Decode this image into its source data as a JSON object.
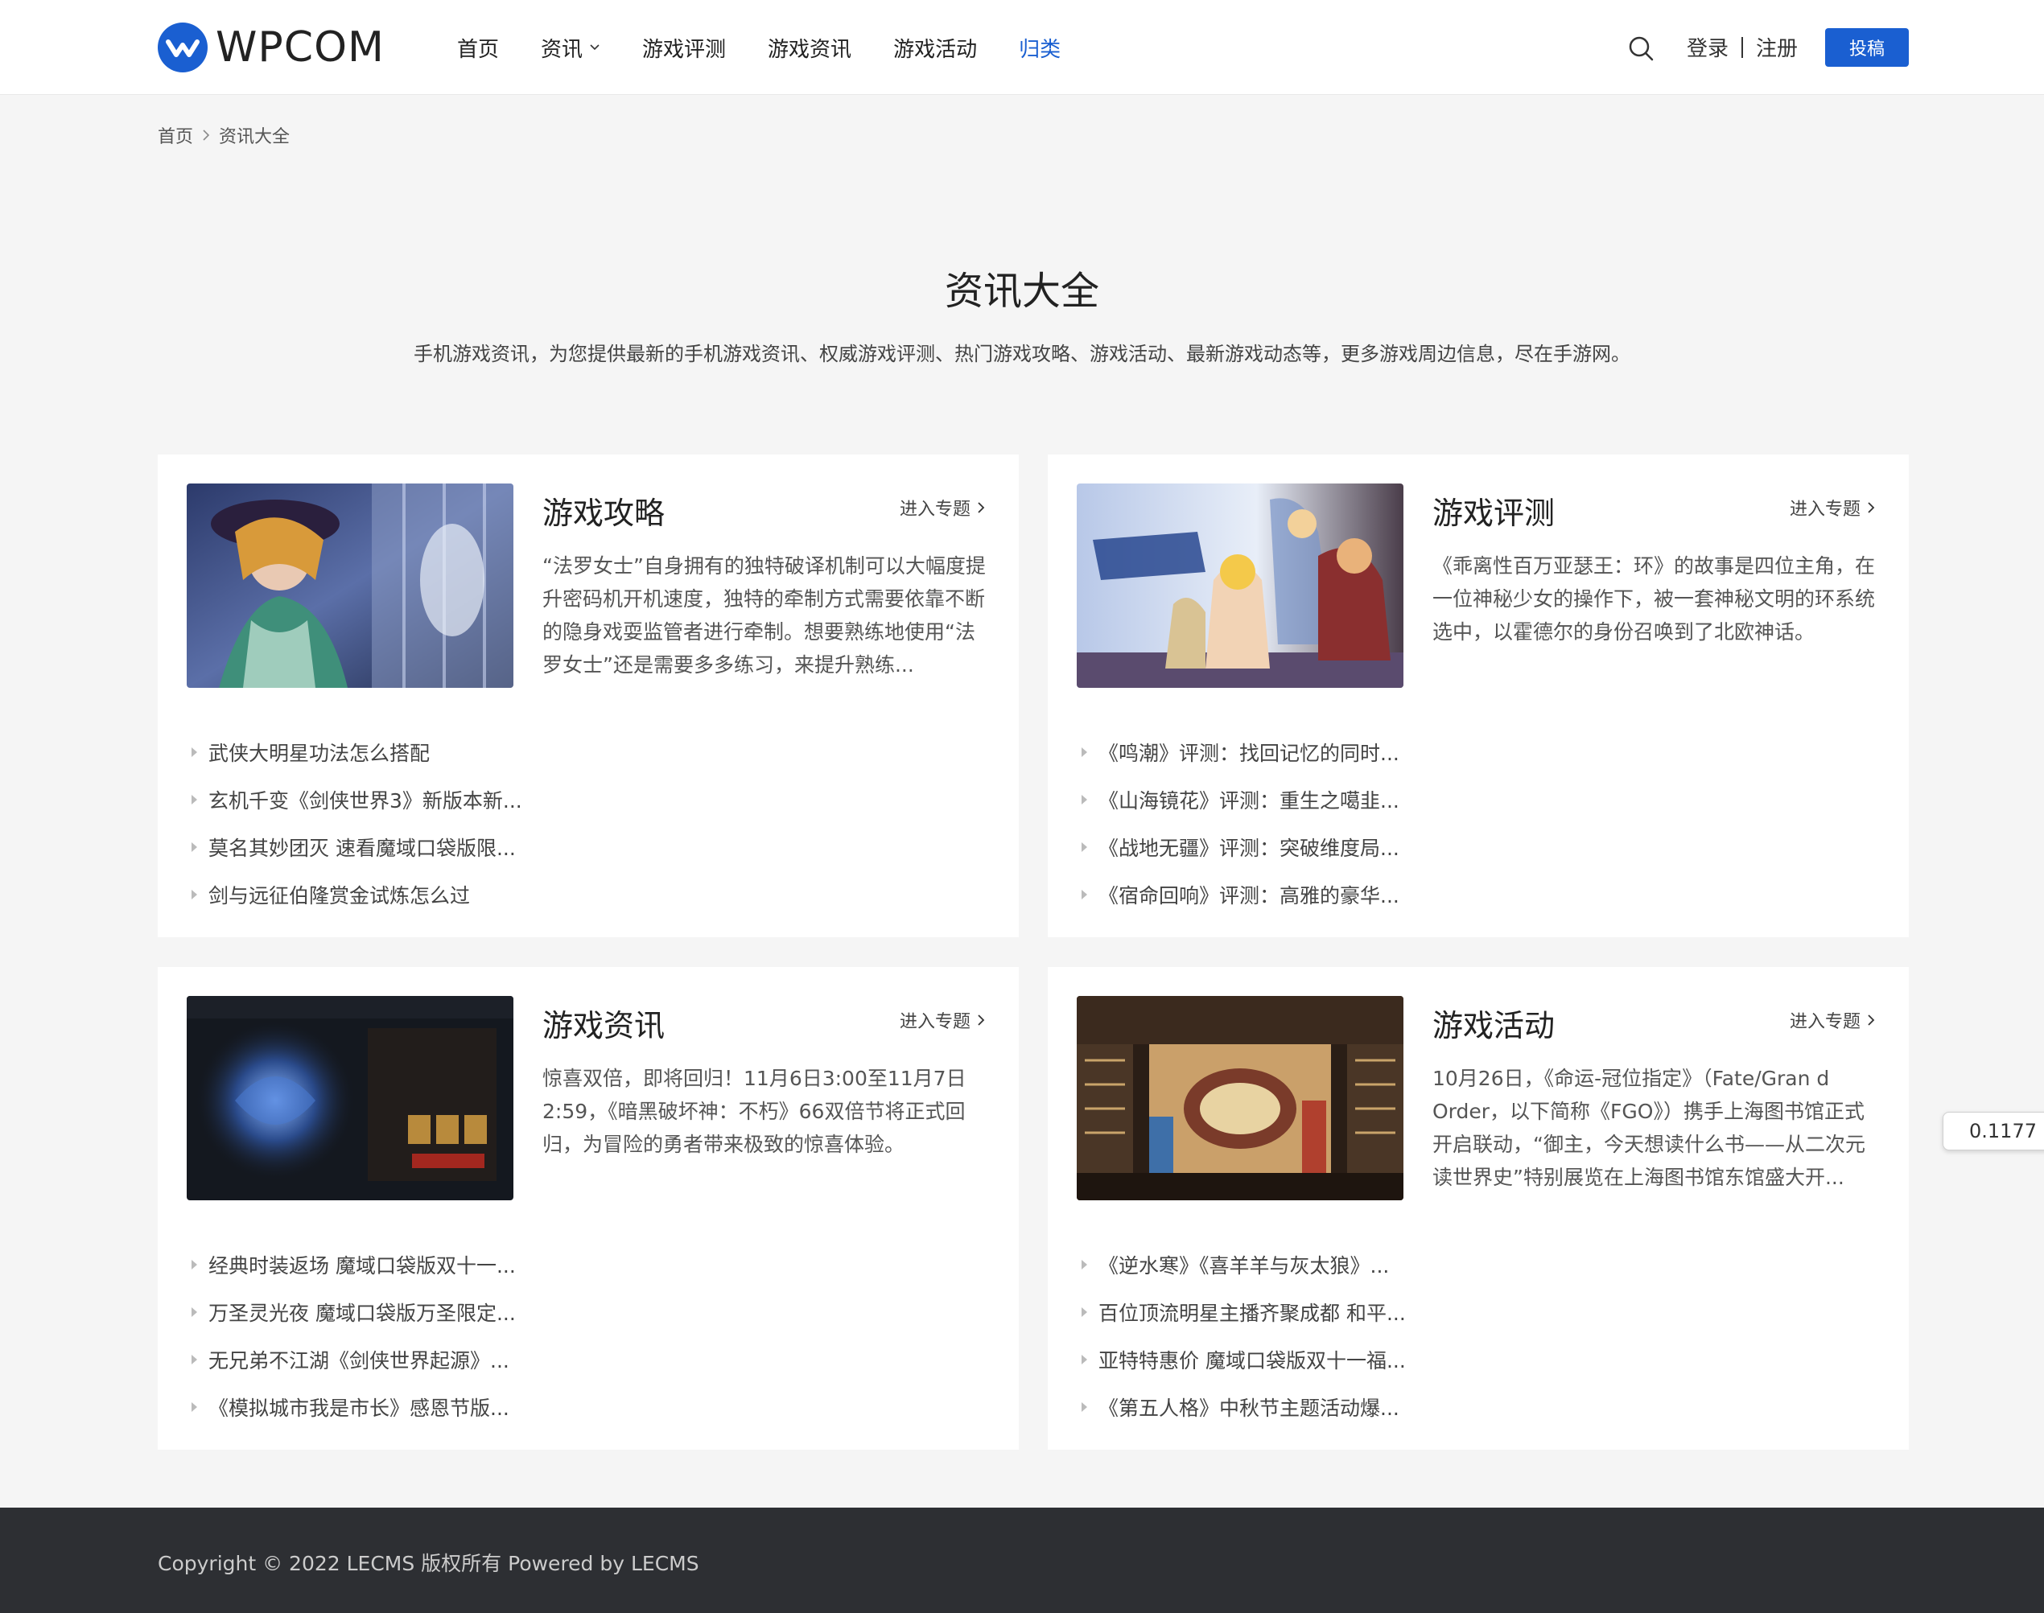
{
  "header": {
    "logo_text": "WPCOM",
    "nav": [
      {
        "label": "首页"
      },
      {
        "label": "资讯"
      },
      {
        "label": "游戏评测"
      },
      {
        "label": "游戏资讯"
      },
      {
        "label": "游戏活动"
      },
      {
        "label": "归类"
      }
    ],
    "login_label": "登录",
    "register_label": "注册",
    "submit_label": "投稿",
    "accent_color": "#1a5fd1"
  },
  "breadcrumb": {
    "home": "首页",
    "current": "资讯大全"
  },
  "page": {
    "title": "资讯大全",
    "description": "手机游戏资讯，为您提供最新的手机游戏资讯、权威游戏评测、热门游戏攻略、游戏活动、最新游戏动态等，更多游戏周边信息，尽在手游网。"
  },
  "cards": [
    {
      "title": "游戏攻略",
      "more_label": "进入专题",
      "excerpt": "“法罗女士”自身拥有的独特破译机制可以大幅度提升密码机开机速度，独特的牵制方式需要依靠不断的隐身戏耍监管者进行牵制。想要熟练地使用“法罗女士”还是需要多多练习，来提升熟练...",
      "items": [
        "武侠大明星功法怎么搭配",
        "玄机千变《剑侠世界3》新版本新...",
        "莫名其妙团灭 速看魔域口袋版限...",
        "剑与远征伯隆赏金试炼怎么过"
      ]
    },
    {
      "title": "游戏评测",
      "more_label": "进入专题",
      "excerpt": "《乖离性百万亚瑟王：环》的故事是四位主角，在一位神秘少女的操作下，被一套神秘文明的环系统选中，以霍德尔的身份召唤到了北欧神话。",
      "items": [
        "《鸣潮》评测：找回记忆的同时...",
        "《山海镜花》评测：重生之噶韭...",
        "《战地无疆》评测：突破维度局...",
        "《宿命回响》评测：高雅的豪华..."
      ]
    },
    {
      "title": "游戏资讯",
      "more_label": "进入专题",
      "excerpt": "惊喜双倍，即将回归！11月6日3:00至11月7日2:59，《暗黑破坏神：不朽》66双倍节将正式回归，为冒险的勇者带来极致的惊喜体验。",
      "items": [
        "经典时装返场 魔域口袋版双十一...",
        "万圣灵光夜 魔域口袋版万圣限定...",
        "无兄弟不江湖《剑侠世界起源》...",
        "《模拟城市我是市长》感恩节版..."
      ]
    },
    {
      "title": "游戏活动",
      "more_label": "进入专题",
      "excerpt": "10月26日，《命运-冠位指定》（Fate/Gran d Order，以下简称《FGO》）携手上海图书馆正式开启联动，“御主，今天想读什么书——从二次元读世界史”特别展览在上海图书馆东馆盛大开...",
      "items": [
        "《逆水寒》《喜羊羊与灰太狼》...",
        "百位顶流明星主播齐聚成都 和平...",
        "亚特特惠价 魔域口袋版双十一福...",
        "《第五人格》中秋节主题活动爆..."
      ]
    }
  ],
  "floating_value": "0.1177",
  "footer": {
    "copyright": "Copyright © 2022 LECMS 版权所有 Powered by LECMS"
  }
}
